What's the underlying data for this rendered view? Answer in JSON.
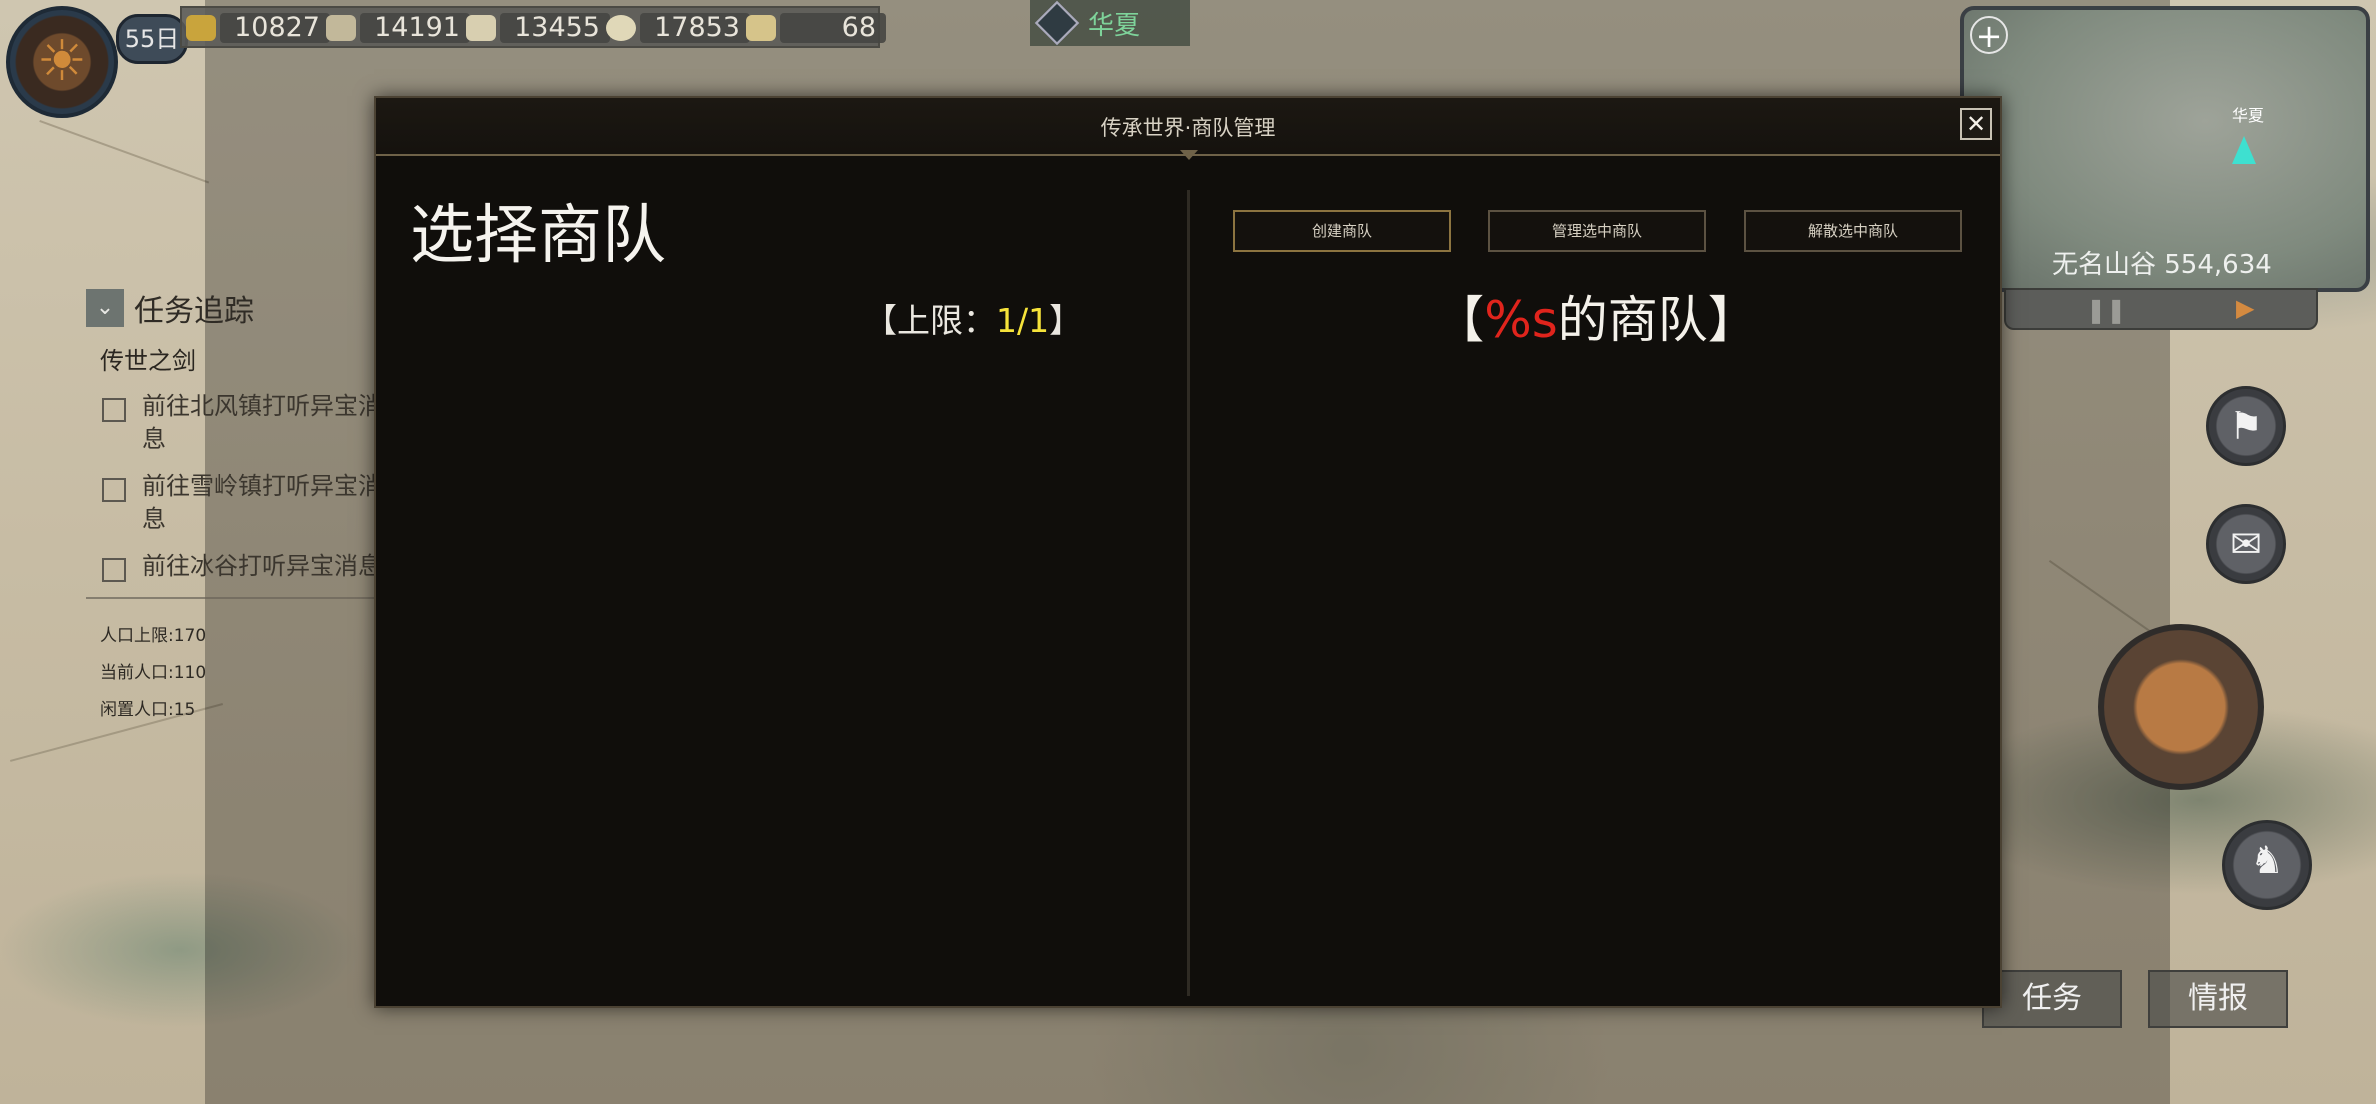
{
  "hud": {
    "day": "55日",
    "resources": [
      {
        "icon": "gold-coin-icon",
        "value": "10827"
      },
      {
        "icon": "iron-ingot-icon",
        "value": "14191"
      },
      {
        "icon": "silver-ingot-icon",
        "value": "13455"
      },
      {
        "icon": "grain-icon",
        "value": "17853"
      },
      {
        "icon": "horn-icon",
        "value": "68"
      }
    ],
    "kingdom": "华夏"
  },
  "quest": {
    "header": "任务追踪",
    "category": "传世之剑",
    "items": [
      {
        "text": "前往北风镇打听异宝消息"
      },
      {
        "text": "前往雪岭镇打听异宝消息"
      },
      {
        "text": "前往冰谷打听异宝消息"
      }
    ],
    "population": {
      "cap": "人口上限:170",
      "current": "当前人口:110",
      "idle": "闲置人口:15"
    }
  },
  "minimap": {
    "region_label": "华夏",
    "location": "无名山谷 554,634"
  },
  "bottom_tabs": [
    "任务",
    "情报"
  ],
  "dialog": {
    "title": "传承世界·商队管理",
    "close": "✕",
    "left_title": "选择商队",
    "limit_prefix": "【上限：",
    "limit_value": "1/1",
    "limit_suffix": "】",
    "buttons": {
      "create": "创建商队",
      "manage": "管理选中商队",
      "disband": "解散选中商队"
    },
    "caravan_open": "【",
    "caravan_placeholder": "%s",
    "caravan_rest": "的商队】"
  },
  "colors": {
    "dialog_bg": "#100e0b",
    "limit_value": "#f5e23a",
    "placeholder": "#e0241c",
    "kingdom_name": "#7ed39a"
  }
}
